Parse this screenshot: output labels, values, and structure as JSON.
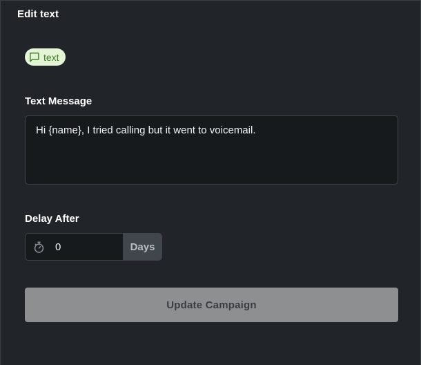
{
  "panel": {
    "title": "Edit text"
  },
  "badge": {
    "icon": "chat-bubble-icon",
    "label": "text",
    "background": "#e4f5d6",
    "color": "#3f7d2a"
  },
  "message": {
    "label": "Text Message",
    "value": "Hi {name}, I tried calling but it went to voicemail."
  },
  "delay": {
    "label": "Delay After",
    "icon": "stopwatch-icon",
    "value": "0",
    "unit": "Days"
  },
  "actions": {
    "update_label": "Update Campaign"
  }
}
